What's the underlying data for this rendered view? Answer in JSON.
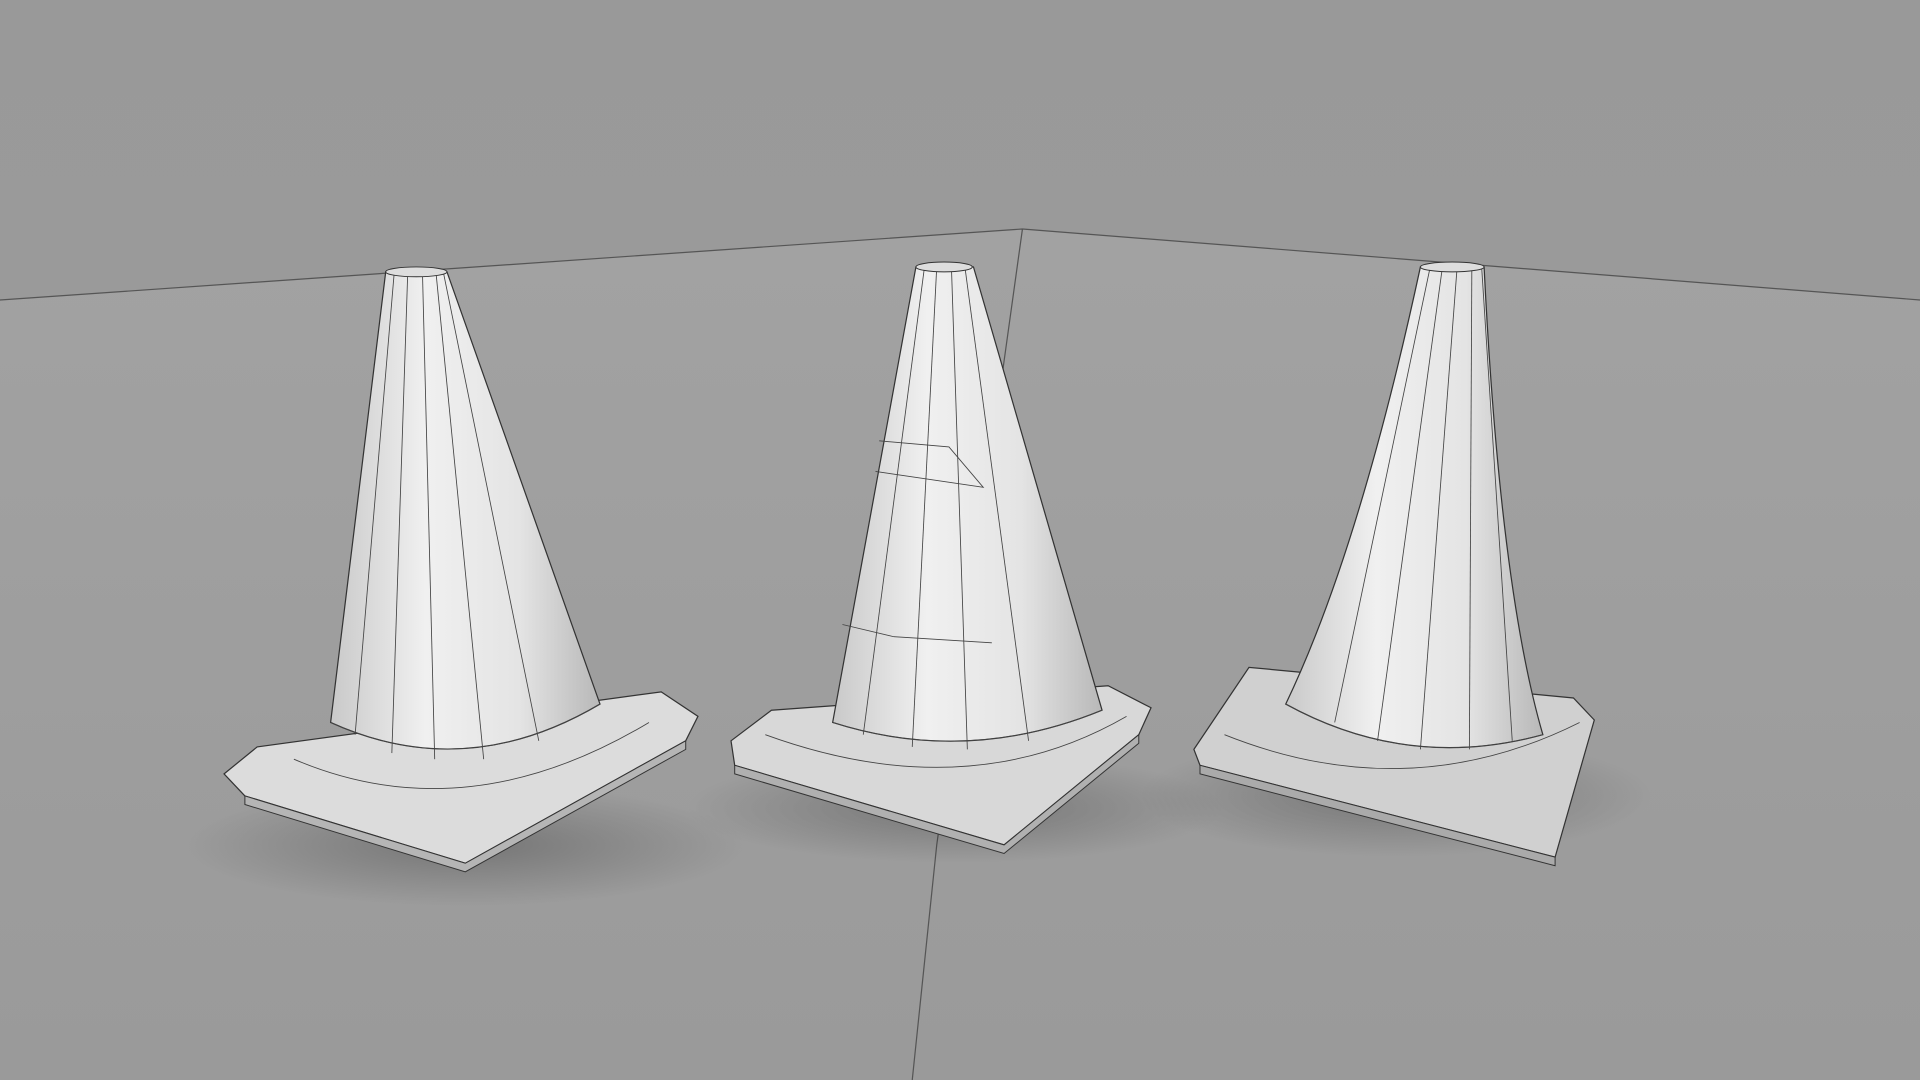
{
  "scene": {
    "colors": {
      "backdrop": "#9a9a9a",
      "floor": "#a1a1a1",
      "cone": "#e6e6e6",
      "wire": "#3a3a3a"
    }
  }
}
